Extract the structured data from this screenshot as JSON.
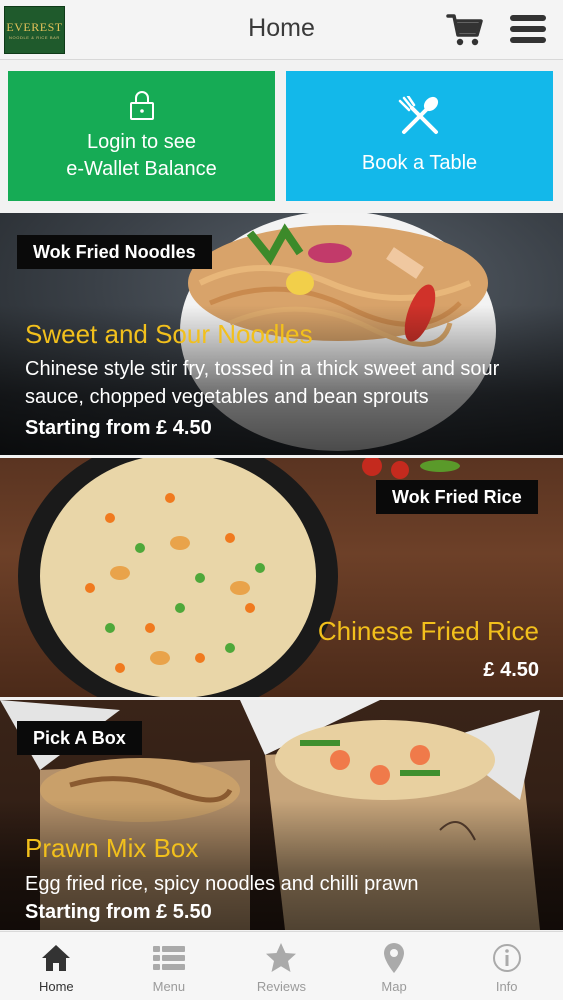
{
  "header": {
    "logo_text": "EVEREST",
    "logo_subtext": "NOODLE & RICE BAR",
    "title": "Home"
  },
  "tiles": {
    "wallet_line1": "Login to see",
    "wallet_line2": "e-Wallet Balance",
    "book_label": "Book a Table"
  },
  "cards": [
    {
      "tag": "Wok Fried Noodles",
      "title": "Sweet and Sour Noodles",
      "description": "Chinese style stir fry, tossed in a thick sweet and sour sauce, chopped vegetables and bean sprouts",
      "price": "Starting from £ 4.50"
    },
    {
      "tag": "Wok Fried Rice",
      "title": "Chinese Fried Rice",
      "price": "£ 4.50"
    },
    {
      "tag": "Pick A Box",
      "title": "Prawn Mix Box",
      "description": "Egg fried rice, spicy noodles and chilli prawn",
      "price": "Starting from £ 5.50"
    }
  ],
  "nav": [
    {
      "label": "Home",
      "icon": "home-icon",
      "active": true
    },
    {
      "label": "Menu",
      "icon": "list-icon",
      "active": false
    },
    {
      "label": "Reviews",
      "icon": "star-icon",
      "active": false
    },
    {
      "label": "Map",
      "icon": "map-pin-icon",
      "active": false
    },
    {
      "label": "Info",
      "icon": "info-icon",
      "active": false
    }
  ],
  "colors": {
    "wallet_tile": "#16ab55",
    "book_tile": "#13b8ea",
    "card_title": "#f2c01c",
    "tag_bg": "#0a0a0a"
  }
}
